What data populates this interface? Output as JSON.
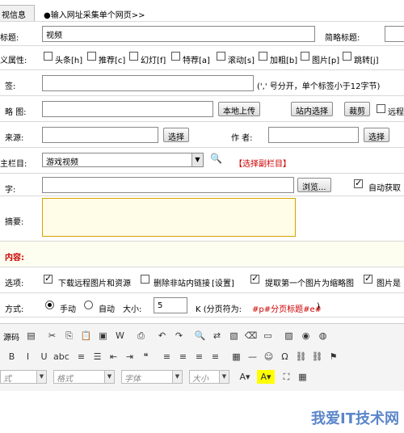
{
  "tabs": {
    "basic": "视信息",
    "url": "●输入网址采集单个网页>>"
  },
  "title": {
    "label": "标题:",
    "value": "视频",
    "short_label": "简略标题:"
  },
  "attrs": {
    "label": "义属性:",
    "items": [
      "头条[h]",
      "推荐[c]",
      "幻灯[f]",
      "特荐[a]",
      "滚动[s]",
      "加粗[b]",
      "图片[p]",
      "跳转[j]"
    ]
  },
  "tags": {
    "label": "签:",
    "hint": "(',' 号分开，单个标签小于12字节)"
  },
  "thumb": {
    "label": "略 图:",
    "upload": "本地上传",
    "site_select": "站内选择",
    "crop": "裁剪",
    "remote": "远程"
  },
  "source": {
    "label": "来源:",
    "select": "选择",
    "author_label": "作 者:",
    "author_select": "选择"
  },
  "column": {
    "label": "主栏目:",
    "value": "游戏视频",
    "sub": "【选择副栏目】"
  },
  "keyword": {
    "label": "字:",
    "browse": "浏览...",
    "auto": "自动获取"
  },
  "summary": {
    "label": "摘要:"
  },
  "content": {
    "label": "内容:"
  },
  "options": {
    "label": "选项:",
    "download": "下载远程图片和资源",
    "delete_links": "删除非站内链接",
    "settings": "[设置]",
    "first_img": "提取第一个图片为缩略图",
    "img_is": "图片是"
  },
  "paging": {
    "label": "方式:",
    "manual": "手动",
    "auto": "自动",
    "size_label": "大小:",
    "size_value": "5",
    "unit": "K (分页符为:",
    "marker": "#p#分页标题#e#",
    "close": ")"
  },
  "editor": {
    "source": "源码",
    "combo_style": "式",
    "combo_format": "格式",
    "combo_font": "字体",
    "combo_size": "大小"
  },
  "watermark": "我爱IT技术网",
  "colors": {
    "highlight_bg": "#fdfdf0",
    "accent": "#c00"
  }
}
